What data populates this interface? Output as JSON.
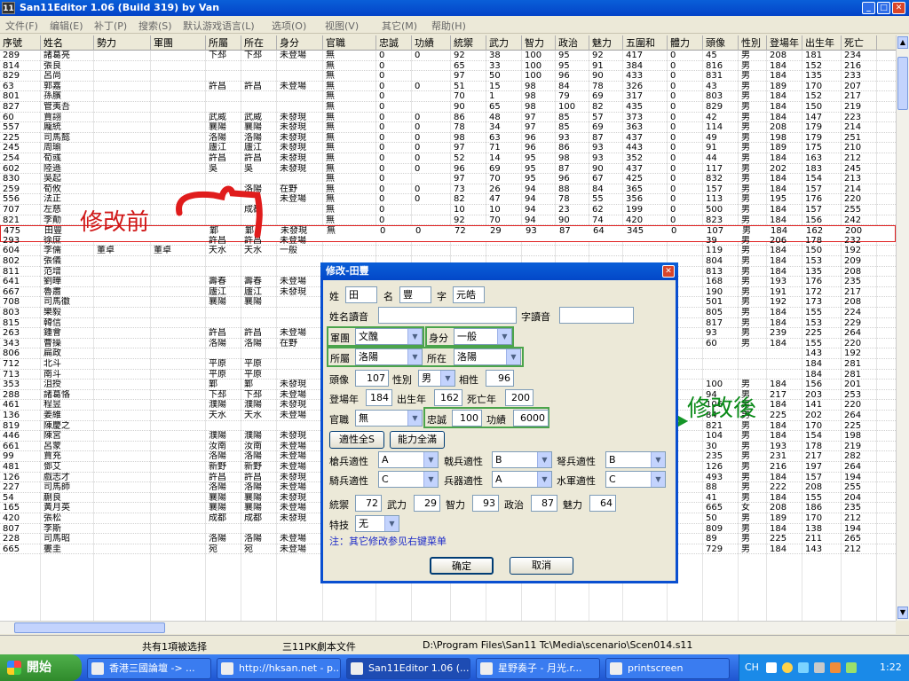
{
  "window": {
    "title": "San11Editor 1.06 (Build 319) by Van",
    "icon_text": "11"
  },
  "menu": [
    "文件(F)",
    "编辑(E)",
    "补丁(P)",
    "搜索(S)",
    "默认游戏语言(L)",
    "选项(O)",
    "视图(V)",
    "其它(M)",
    "帮助(H)"
  ],
  "columns": [
    "序號",
    "姓名",
    "勢力",
    "軍團",
    "所屬",
    "所在",
    "身分",
    "官職",
    "忠誠",
    "功績",
    "統禦",
    "武力",
    "智力",
    "政治",
    "魅力",
    "五圍和",
    "體力",
    "頭像",
    "性別",
    "登場年",
    "出生年",
    "死亡"
  ],
  "rows": [
    [
      "289",
      "諸葛亮",
      "",
      "",
      "下邳",
      "下邳",
      "未登場",
      "無",
      "0",
      "0",
      "92",
      "38",
      "100",
      "95",
      "92",
      "417",
      "0",
      "45",
      "男",
      "208",
      "181",
      "234"
    ],
    [
      "814",
      "張良",
      "",
      "",
      "",
      "",
      "",
      "無",
      "0",
      "",
      "65",
      "33",
      "100",
      "95",
      "91",
      "384",
      "0",
      "816",
      "男",
      "184",
      "152",
      "216"
    ],
    [
      "829",
      "呂尚",
      "",
      "",
      "",
      "",
      "",
      "無",
      "0",
      "",
      "97",
      "50",
      "100",
      "96",
      "90",
      "433",
      "0",
      "831",
      "男",
      "184",
      "135",
      "233"
    ],
    [
      "63",
      "郭嘉",
      "",
      "",
      "許昌",
      "許昌",
      "未登場",
      "無",
      "0",
      "0",
      "51",
      "15",
      "98",
      "84",
      "78",
      "326",
      "0",
      "43",
      "男",
      "189",
      "170",
      "207"
    ],
    [
      "801",
      "孫臏",
      "",
      "",
      "",
      "",
      "",
      "無",
      "0",
      "",
      "70",
      "1",
      "98",
      "79",
      "69",
      "317",
      "0",
      "803",
      "男",
      "184",
      "152",
      "217"
    ],
    [
      "827",
      "管夷吾",
      "",
      "",
      "",
      "",
      "",
      "無",
      "0",
      "",
      "90",
      "65",
      "98",
      "100",
      "82",
      "435",
      "0",
      "829",
      "男",
      "184",
      "150",
      "219"
    ],
    [
      "60",
      "賈詡",
      "",
      "",
      "武威",
      "武威",
      "未發現",
      "無",
      "0",
      "0",
      "86",
      "48",
      "97",
      "85",
      "57",
      "373",
      "0",
      "42",
      "男",
      "184",
      "147",
      "223"
    ],
    [
      "557",
      "龐統",
      "",
      "",
      "襄陽",
      "襄陽",
      "未發現",
      "無",
      "0",
      "0",
      "78",
      "34",
      "97",
      "85",
      "69",
      "363",
      "0",
      "114",
      "男",
      "208",
      "179",
      "214"
    ],
    [
      "225",
      "司馬懿",
      "",
      "",
      "洛陽",
      "洛陽",
      "未發現",
      "無",
      "0",
      "0",
      "98",
      "63",
      "96",
      "93",
      "87",
      "437",
      "0",
      "49",
      "男",
      "198",
      "179",
      "251"
    ],
    [
      "245",
      "周瑜",
      "",
      "",
      "廬江",
      "廬江",
      "未發現",
      "無",
      "0",
      "0",
      "97",
      "71",
      "96",
      "86",
      "93",
      "443",
      "0",
      "91",
      "男",
      "189",
      "175",
      "210"
    ],
    [
      "254",
      "荀彧",
      "",
      "",
      "許昌",
      "許昌",
      "未發現",
      "無",
      "0",
      "0",
      "52",
      "14",
      "95",
      "98",
      "93",
      "352",
      "0",
      "44",
      "男",
      "184",
      "163",
      "212"
    ],
    [
      "602",
      "陸遜",
      "",
      "",
      "吳",
      "吳",
      "未發現",
      "無",
      "0",
      "0",
      "96",
      "69",
      "95",
      "87",
      "90",
      "437",
      "0",
      "117",
      "男",
      "202",
      "183",
      "245"
    ],
    [
      "830",
      "吳起",
      "",
      "",
      "",
      "",
      "",
      "無",
      "0",
      "",
      "97",
      "70",
      "95",
      "96",
      "67",
      "425",
      "0",
      "832",
      "男",
      "184",
      "154",
      "213"
    ],
    [
      "259",
      "荀攸",
      "",
      "",
      "",
      "洛陽",
      "在野",
      "無",
      "0",
      "0",
      "73",
      "26",
      "94",
      "88",
      "84",
      "365",
      "0",
      "157",
      "男",
      "184",
      "157",
      "214"
    ],
    [
      "556",
      "法正",
      "",
      "",
      "",
      "",
      "未登場",
      "無",
      "0",
      "0",
      "82",
      "47",
      "94",
      "78",
      "55",
      "356",
      "0",
      "113",
      "男",
      "195",
      "176",
      "220"
    ],
    [
      "707",
      "左慈",
      "",
      "",
      "",
      "成都",
      "",
      "無",
      "0",
      "",
      "10",
      "10",
      "94",
      "23",
      "62",
      "199",
      "0",
      "500",
      "男",
      "184",
      "157",
      "255"
    ],
    [
      "821",
      "李勣",
      "",
      "",
      "",
      "",
      "",
      "無",
      "0",
      "",
      "92",
      "70",
      "94",
      "90",
      "74",
      "420",
      "0",
      "823",
      "男",
      "184",
      "156",
      "242"
    ],
    [
      "475",
      "田豐",
      "",
      "",
      "鄴",
      "鄴",
      "未發現",
      "無",
      "0",
      "0",
      "72",
      "29",
      "93",
      "87",
      "64",
      "345",
      "0",
      "107",
      "男",
      "184",
      "162",
      "200"
    ],
    [
      "293",
      "徐庶",
      "",
      "",
      "許昌",
      "許昌",
      "未登場",
      "",
      "",
      "",
      "",
      "",
      "",
      "",
      "",
      "",
      "",
      "39",
      "男",
      "206",
      "178",
      "232"
    ],
    [
      "604",
      "李儒",
      "董卓",
      "董卓",
      "天水",
      "天水",
      "一般",
      "",
      "",
      "",
      "",
      "",
      "",
      "",
      "",
      "",
      "",
      "119",
      "男",
      "184",
      "150",
      "192"
    ],
    [
      "802",
      "張儀",
      "",
      "",
      "",
      "",
      "",
      "",
      "",
      "",
      "",
      "",
      "",
      "",
      "",
      "",
      "",
      "804",
      "男",
      "184",
      "153",
      "209"
    ],
    [
      "811",
      "范增",
      "",
      "",
      "",
      "",
      "",
      "",
      "",
      "",
      "",
      "",
      "",
      "",
      "",
      "",
      "",
      "813",
      "男",
      "184",
      "135",
      "208"
    ],
    [
      "641",
      "劉曄",
      "",
      "",
      "壽春",
      "壽春",
      "未登場",
      "",
      "",
      "",
      "",
      "",
      "",
      "",
      "",
      "",
      "",
      "168",
      "男",
      "193",
      "176",
      "235"
    ],
    [
      "667",
      "魯肅",
      "",
      "",
      "廬江",
      "廬江",
      "未發現",
      "",
      "",
      "",
      "",
      "",
      "",
      "",
      "",
      "",
      "",
      "190",
      "男",
      "191",
      "172",
      "217"
    ],
    [
      "708",
      "司馬徽",
      "",
      "",
      "襄陽",
      "襄陽",
      "",
      "",
      "",
      "",
      "",
      "",
      "",
      "",
      "",
      "",
      "",
      "501",
      "男",
      "192",
      "173",
      "208"
    ],
    [
      "803",
      "樂毅",
      "",
      "",
      "",
      "",
      "",
      "",
      "",
      "",
      "",
      "",
      "",
      "",
      "",
      "",
      "",
      "805",
      "男",
      "184",
      "155",
      "224"
    ],
    [
      "815",
      "韓信",
      "",
      "",
      "",
      "",
      "",
      "",
      "",
      "",
      "",
      "",
      "",
      "",
      "",
      "",
      "",
      "817",
      "男",
      "184",
      "153",
      "229"
    ],
    [
      "263",
      "鍾會",
      "",
      "",
      "許昌",
      "許昌",
      "未登場",
      "",
      "",
      "",
      "",
      "",
      "",
      "",
      "",
      "",
      "",
      "93",
      "男",
      "239",
      "225",
      "264"
    ],
    [
      "343",
      "曹操",
      "",
      "",
      "洛陽",
      "洛陽",
      "在野",
      "",
      "",
      "",
      "",
      "",
      "",
      "",
      "",
      "",
      "",
      "60",
      "男",
      "184",
      "155",
      "220"
    ],
    [
      "806",
      "扁政",
      "",
      "",
      "",
      "",
      "",
      "",
      "",
      "",
      "",
      "",
      "",
      "",
      "",
      "",
      "",
      "",
      "",
      "",
      "143",
      "192"
    ],
    [
      "712",
      "北斗",
      "",
      "",
      "平原",
      "平原",
      "",
      "",
      "",
      "",
      "",
      "",
      "",
      "",
      "",
      "",
      "",
      "",
      "",
      "",
      "184",
      "281"
    ],
    [
      "713",
      "南斗",
      "",
      "",
      "平原",
      "平原",
      "",
      "",
      "",
      "",
      "",
      "",
      "",
      "",
      "",
      "",
      "",
      "",
      "",
      "",
      "184",
      "281"
    ],
    [
      "353",
      "沮授",
      "",
      "",
      "鄴",
      "鄴",
      "未發現",
      "",
      "",
      "",
      "",
      "",
      "",
      "",
      "",
      "",
      "",
      "100",
      "男",
      "184",
      "156",
      "201"
    ],
    [
      "288",
      "諸葛恪",
      "",
      "",
      "下邳",
      "下邳",
      "未登場",
      "",
      "",
      "",
      "",
      "",
      "",
      "",
      "",
      "",
      "",
      "94",
      "男",
      "217",
      "203",
      "253"
    ],
    [
      "461",
      "程昱",
      "",
      "",
      "濮陽",
      "濮陽",
      "未發現",
      "",
      "",
      "",
      "",
      "",
      "",
      "",
      "",
      "",
      "",
      "106",
      "男",
      "184",
      "141",
      "220"
    ],
    [
      "136",
      "姜維",
      "",
      "",
      "天水",
      "天水",
      "未登場",
      "",
      "",
      "",
      "",
      "",
      "",
      "",
      "",
      "",
      "",
      "84",
      "男",
      "225",
      "202",
      "264"
    ],
    [
      "819",
      "陳慶之",
      "",
      "",
      "",
      "",
      "",
      "",
      "",
      "",
      "",
      "",
      "",
      "",
      "",
      "",
      "",
      "821",
      "男",
      "184",
      "170",
      "225"
    ],
    [
      "446",
      "陳宮",
      "",
      "",
      "濮陽",
      "濮陽",
      "未發現",
      "",
      "",
      "",
      "",
      "",
      "",
      "",
      "",
      "",
      "",
      "104",
      "男",
      "184",
      "154",
      "198"
    ],
    [
      "661",
      "呂蒙",
      "",
      "",
      "汝南",
      "汝南",
      "未登場",
      "",
      "",
      "",
      "",
      "",
      "",
      "",
      "",
      "",
      "",
      "30",
      "男",
      "193",
      "178",
      "219"
    ],
    [
      "99",
      "賈充",
      "",
      "",
      "洛陽",
      "洛陽",
      "未登場",
      "",
      "",
      "",
      "",
      "",
      "",
      "",
      "",
      "",
      "",
      "235",
      "男",
      "231",
      "217",
      "282"
    ],
    [
      "481",
      "鄧艾",
      "",
      "",
      "新野",
      "新野",
      "未登場",
      "",
      "",
      "",
      "",
      "",
      "",
      "",
      "",
      "",
      "",
      "126",
      "男",
      "216",
      "197",
      "264"
    ],
    [
      "126",
      "戲志才",
      "",
      "",
      "許昌",
      "許昌",
      "未發現",
      "",
      "",
      "",
      "",
      "",
      "",
      "",
      "",
      "",
      "",
      "493",
      "男",
      "184",
      "157",
      "194"
    ],
    [
      "227",
      "司馬師",
      "",
      "",
      "洛陽",
      "洛陽",
      "未登場",
      "",
      "",
      "",
      "",
      "",
      "",
      "",
      "",
      "",
      "",
      "88",
      "男",
      "222",
      "208",
      "255"
    ],
    [
      "54",
      "蒯良",
      "",
      "",
      "襄陽",
      "襄陽",
      "未發現",
      "",
      "",
      "",
      "",
      "",
      "",
      "",
      "",
      "",
      "",
      "41",
      "男",
      "184",
      "155",
      "204"
    ],
    [
      "165",
      "黃月英",
      "",
      "",
      "襄陽",
      "襄陽",
      "未登場",
      "",
      "",
      "",
      "",
      "",
      "",
      "",
      "",
      "",
      "",
      "665",
      "女",
      "208",
      "186",
      "235"
    ],
    [
      "420",
      "張松",
      "",
      "",
      "成都",
      "成都",
      "未發現",
      "",
      "",
      "",
      "",
      "",
      "",
      "",
      "",
      "",
      "",
      "50",
      "男",
      "189",
      "170",
      "212"
    ],
    [
      "807",
      "李斯",
      "",
      "",
      "",
      "",
      "",
      "無",
      "",
      "",
      "15",
      "24",
      "88",
      "98",
      "40",
      "265",
      "0",
      "809",
      "男",
      "184",
      "138",
      "194"
    ],
    [
      "228",
      "司馬昭",
      "",
      "",
      "洛陽",
      "洛陽",
      "未登場",
      "無",
      "0",
      "0",
      "76",
      "57",
      "87",
      "88",
      "80",
      "388",
      "0",
      "89",
      "男",
      "225",
      "211",
      "265"
    ],
    [
      "665",
      "婁圭",
      "",
      "",
      "宛",
      "宛",
      "未登場",
      "無",
      "0",
      "0",
      "52",
      "13",
      "87",
      "67",
      "15",
      "234",
      "0",
      "729",
      "男",
      "184",
      "143",
      "212"
    ]
  ],
  "selected_row_index": 17,
  "status": {
    "selection": "共有1項被选择",
    "filetype": "三11PK劇本文件",
    "path": "D:\\Program Files\\San11 Tc\\Media\\scenario\\Scen014.s11"
  },
  "taskbar": {
    "start": "開始",
    "tasks": [
      "香港三國論壇 -> ...",
      "http://hksan.net - p...",
      "San11Editor 1.06 (...",
      "星野奏子 - 月光.r...",
      "printscreen"
    ],
    "lang": "CH",
    "clock": "1:22"
  },
  "annotations": {
    "before": "修改前",
    "after": "修改後"
  },
  "dialog": {
    "title": "修改-田豐",
    "surname_label": "姓",
    "surname": "田",
    "given_label": "名",
    "given": "豐",
    "style_label": "字",
    "style": "元皓",
    "name_reading_label": "姓名讀音",
    "name_reading": "",
    "style_reading_label": "字讀音",
    "style_reading": "",
    "corps_label": "軍團",
    "corps": "文醜",
    "status_label": "身分",
    "status": "一般",
    "belong_label": "所屬",
    "belong": "洛陽",
    "location_label": "所在",
    "location": "洛陽",
    "portrait_label": "頭像",
    "portrait": "107",
    "gender_label": "性別",
    "gender": "男",
    "compat_label": "相性",
    "compat": "96",
    "appear_label": "登場年",
    "appear": "184",
    "birth_label": "出生年",
    "birth": "162",
    "death_label": "死亡年",
    "death": "200",
    "rank_label": "官職",
    "rank": "無",
    "loyalty_label": "忠誠",
    "loyalty": "100",
    "merit_label": "功績",
    "merit": "6000",
    "btn_apt": "適性全S",
    "btn_ability": "能力全滿",
    "spear_label": "槍兵適性",
    "spear": "A",
    "halberd_label": "戟兵適性",
    "halberd": "B",
    "bow_label": "弩兵適性",
    "bow": "B",
    "cav_label": "騎兵適性",
    "cav": "C",
    "siege_label": "兵器適性",
    "siege": "A",
    "navy_label": "水軍適性",
    "navy": "C",
    "lead_label": "統禦",
    "lead": "72",
    "war_label": "武力",
    "war": "29",
    "int_label": "智力",
    "int": "93",
    "pol_label": "政治",
    "pol": "87",
    "chr_label": "魅力",
    "chr": "64",
    "skill_label": "特技",
    "skill": "无",
    "note": "注：其它修改参见右键菜单",
    "ok": "确定",
    "cancel": "取消"
  }
}
